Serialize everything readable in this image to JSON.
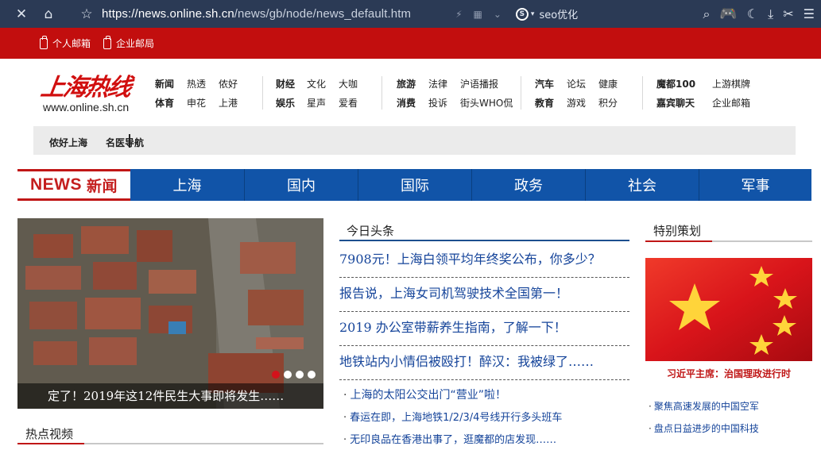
{
  "browser": {
    "url_host": "https://news.online.sh.cn",
    "url_path": "/news/gb/node/news_default.htm",
    "search_label": "seo优化",
    "accent": "#2b3a55"
  },
  "top_strip": {
    "personal_mail": "个人邮箱",
    "company_mail": "企业邮局",
    "color": "#c20e0e"
  },
  "logo": {
    "title": "上海热线",
    "url": "www.online.sh.cn"
  },
  "nav": {
    "g1": [
      "新闻",
      "热透",
      "侬好",
      "体育",
      "申花",
      "上港"
    ],
    "g2": [
      "财经",
      "文化",
      "大咖",
      "娱乐",
      "星声",
      "爱看"
    ],
    "g3": [
      "旅游",
      "法律",
      "沪语播报",
      "消费",
      "投诉",
      "街头WHO侃"
    ],
    "g4": [
      "汽车",
      "论坛",
      "健康",
      "教育",
      "游戏",
      "积分"
    ],
    "g5": [
      "魔都100",
      "上游棋牌",
      "嘉宾聊天",
      "企业邮箱"
    ]
  },
  "subnav": {
    "item1": "侬好上海",
    "item2": "名医导航"
  },
  "news_bar": {
    "logo_en": "NEWS",
    "logo_cn": "新闻",
    "tabs": [
      "上海",
      "国内",
      "国际",
      "政务",
      "社会",
      "军事"
    ],
    "color": "#1154a8"
  },
  "hero": {
    "caption": "定了！2019年这12件民生大事即将发生……",
    "slide_count": 4,
    "active_slide": 1
  },
  "today": {
    "title": "今日头条",
    "headlines": [
      "7908元！上海白领平均年终奖公布，你多少？",
      "报告说，上海女司机驾驶技术全国第一！",
      "2019 办公室带薪养生指南，了解一下！",
      "地铁站内小情侣被殴打！醉汉：我被绿了……"
    ],
    "subitems": [
      "上海的太阳公交出门“营业”啦！",
      "春运在即，上海地铁1/2/3/4号线开行多头班车",
      "无印良品在香港出事了，逛魔都的店发现……"
    ]
  },
  "special": {
    "title": "特别策划",
    "caption": "习近平主席：治国理政进行时",
    "items": [
      "聚焦高速发展的中国空军",
      "盘点日益进步的中国科技"
    ]
  },
  "hot_video": {
    "title": "热点视频"
  }
}
